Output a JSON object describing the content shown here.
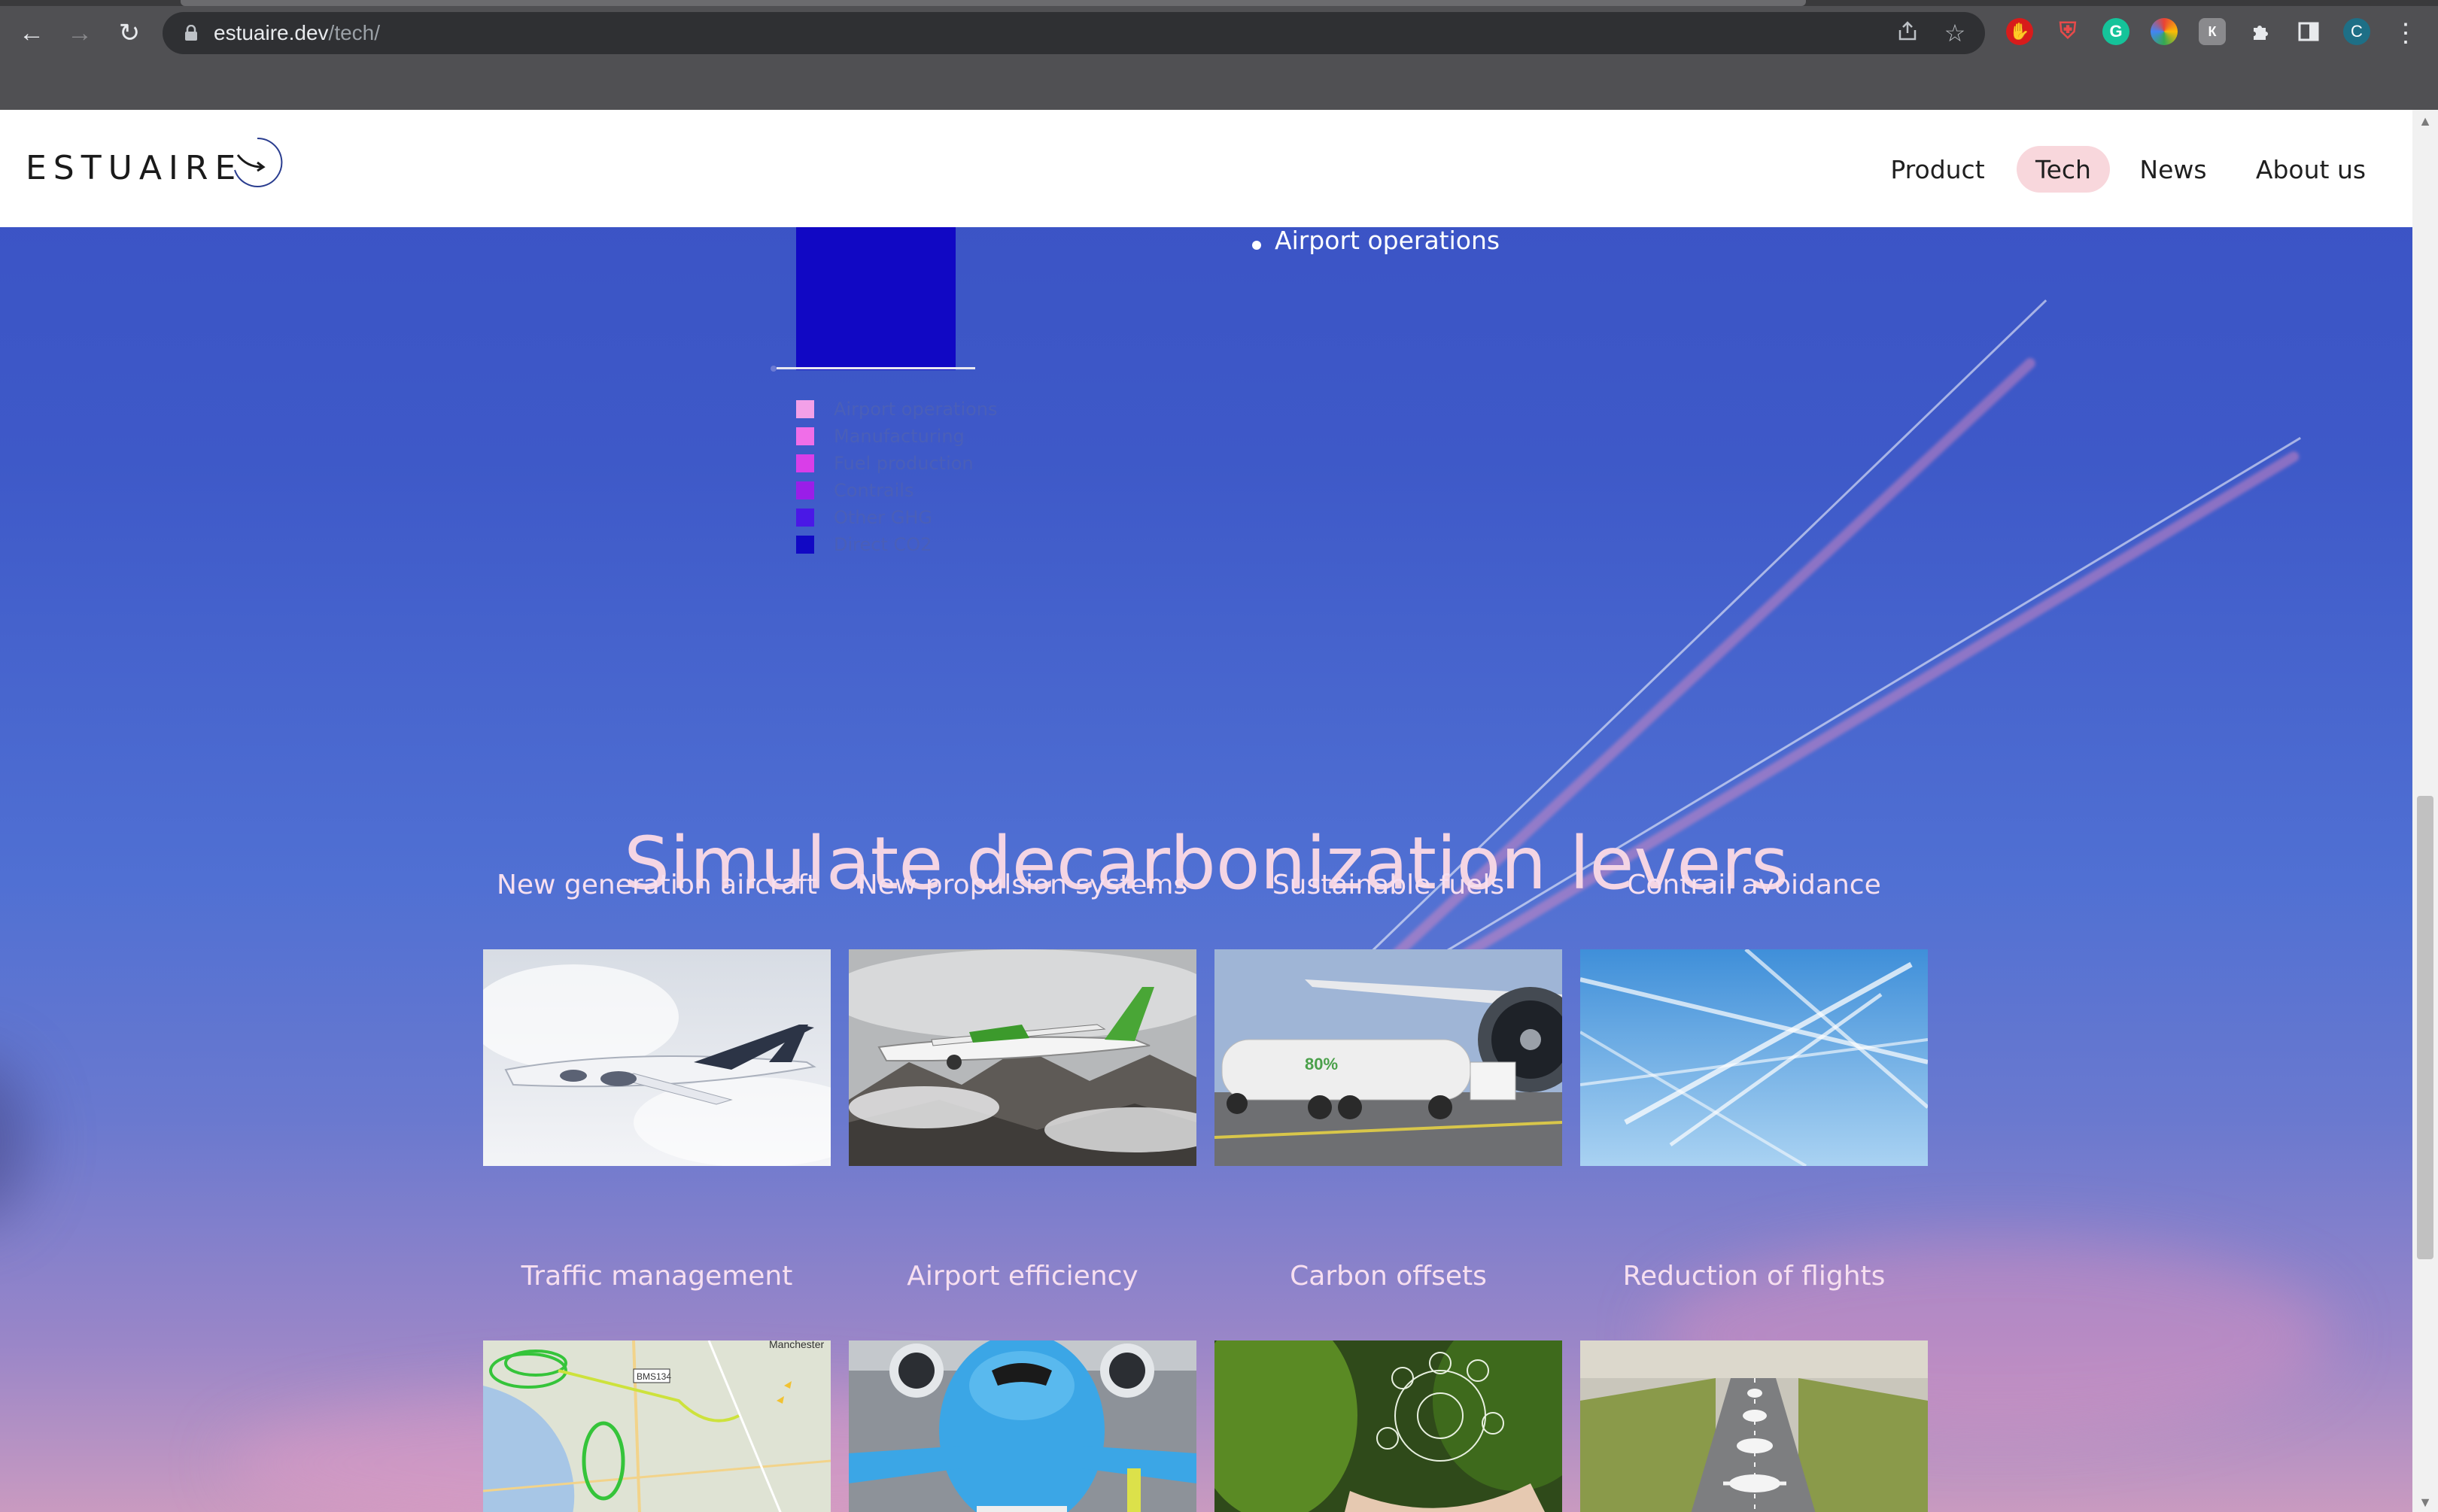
{
  "browser": {
    "url_domain": "estuaire.dev",
    "url_path": "/tech/",
    "profile_initial": "C"
  },
  "site": {
    "logo": "ESTUAIRE",
    "nav": [
      {
        "label": "Product",
        "active": false
      },
      {
        "label": "Tech",
        "active": true
      },
      {
        "label": "News",
        "active": false
      },
      {
        "label": "About us",
        "active": false
      }
    ]
  },
  "chart_fragment": {
    "legend": [
      {
        "label": "Airport operations",
        "color": "#f3a0e8"
      },
      {
        "label": "Manufacturing",
        "color": "#f06ee8"
      },
      {
        "label": "Fuel production",
        "color": "#d93ee8"
      },
      {
        "label": "Contrails",
        "color": "#9a1ee8"
      },
      {
        "label": "Other GHG",
        "color": "#4a18e6"
      },
      {
        "label": "Direct CO2",
        "color": "#1108c4"
      }
    ],
    "bullet": "Airport operations"
  },
  "levers": {
    "title": "Simulate decarbonization levers",
    "items": [
      {
        "label": "New generation aircraft"
      },
      {
        "label": "New propulsion systems"
      },
      {
        "label": "Sustainable fuels"
      },
      {
        "label": "Contrail avoidance"
      },
      {
        "label": "Traffic management"
      },
      {
        "label": "Airport efficiency"
      },
      {
        "label": "Carbon offsets"
      },
      {
        "label": "Reduction of flights"
      }
    ]
  },
  "colors": {
    "accent_nav": "#f8d7dc",
    "title_text": "#f4d5e4",
    "background_top": "#3a52c4",
    "background_bottom": "#c99ac0"
  }
}
